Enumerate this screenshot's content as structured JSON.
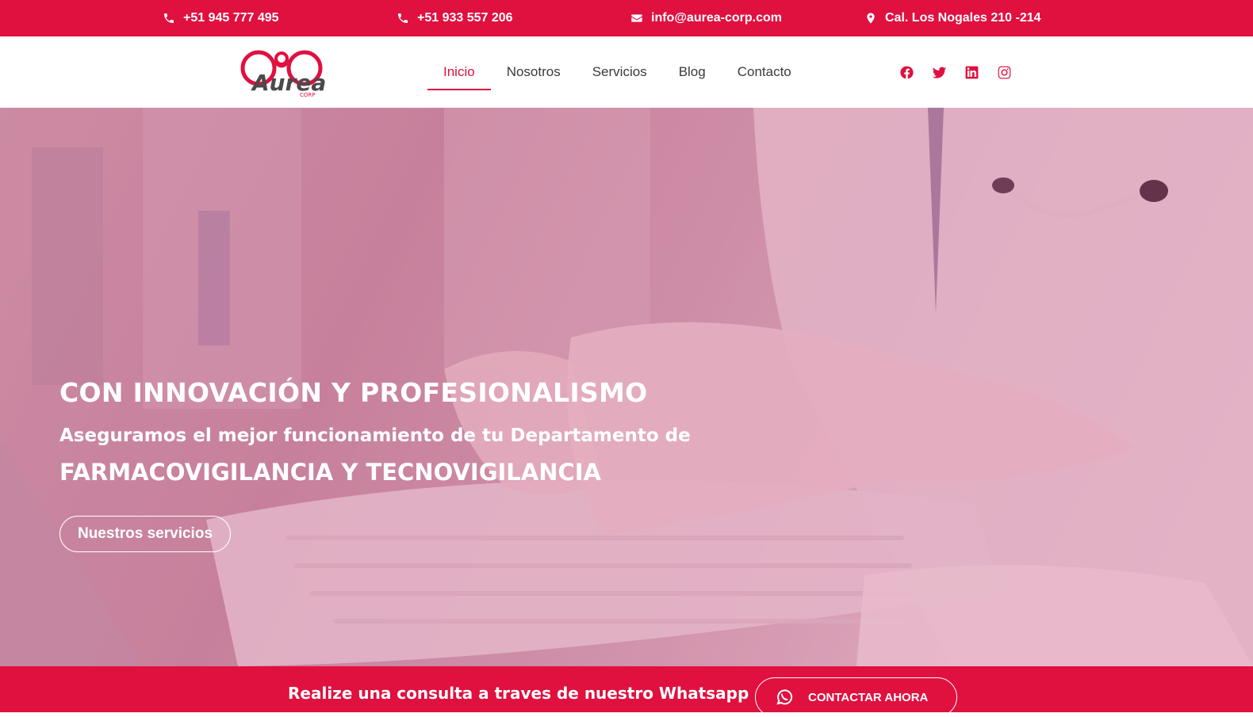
{
  "topbar": {
    "phone1": "+51 945 777 495",
    "phone2": "+51 933 557 206",
    "email": "info@aurea-corp.com",
    "address": "Cal. Los Nogales 210 -214"
  },
  "header": {
    "logo_text": "Aurea",
    "logo_sub": "CORP",
    "nav": [
      {
        "label": "Inicio",
        "active": true
      },
      {
        "label": "Nosotros",
        "active": false
      },
      {
        "label": "Servicios",
        "active": false
      },
      {
        "label": "Blog",
        "active": false
      },
      {
        "label": "Contacto",
        "active": false
      }
    ],
    "social": [
      "facebook-icon",
      "twitter-icon",
      "linkedin-icon",
      "instagram-icon"
    ]
  },
  "hero": {
    "title": "CON INNOVACIÓN Y PROFESIONALISMO",
    "subtitle": "Aseguramos el mejor funcionamiento de tu Departamento de",
    "title2": "FARMACOVIGILANCIA Y TECNOVIGILANCIA",
    "button_label": "Nuestros servicios"
  },
  "bottombar": {
    "text": "Realize una consulta a traves de nuestro Whatsapp",
    "button_label": "CONTACTAR AHORA"
  },
  "colors": {
    "brand": "#e0103f",
    "text_dark": "#3a3a3a",
    "white": "#ffffff"
  }
}
